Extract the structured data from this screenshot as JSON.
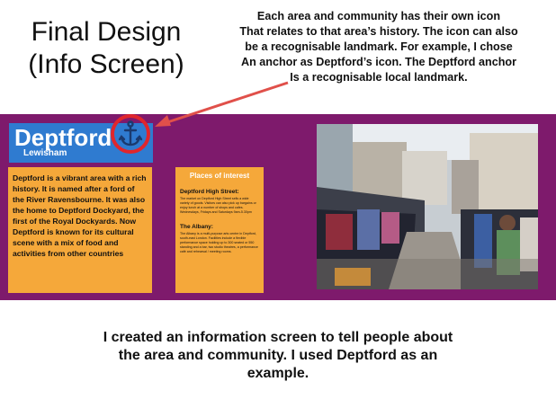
{
  "slide": {
    "title_line1": "Final Design",
    "title_line2": "(Info Screen)",
    "note_lines": [
      "Each area and community has their own icon",
      "That relates to that area’s history. The icon can also",
      "be a recognisable landmark. For example, I chose",
      "An anchor as Deptford’s icon. The Deptford anchor",
      "Is a recognisable local landmark."
    ],
    "caption_lines": [
      "I created an information screen to tell people about",
      "the area and community. I used Deptford as an",
      "example."
    ]
  },
  "screen": {
    "area_name": "Deptford",
    "borough": "Lewisham",
    "icon": "anchor-icon",
    "description": "Deptford is a vibrant area with a rich history. It is named after a ford of the River Ravensbourne. It was also the home to Deptford Dockyard, the first of the Royal Dockyards. Now Deptford is known for its cultural scene with a mix of food and activities from other countries",
    "places_heading": "Places of interest",
    "places": [
      {
        "name": "Deptford High Street:",
        "details": "The market on Deptford High Street sells a wide variety of goods. Visitors can also pick up bargains or enjoy lunch at a number of shops and cafes. Wednesdays, Fridays and Saturdays 9am-5.30pm"
      },
      {
        "name": "The Albany:",
        "details": "The Albany is a multi-purpose arts centre in Deptford, south-east London. Facilities include a flexible performance space holding up to 300 seated or 550 standing and a bar, two studio theatres, a performance café and rehearsal / meeting rooms."
      }
    ],
    "photo": "Street market photo"
  },
  "colors": {
    "band": "#7e1a6c",
    "header": "#2f7bd0",
    "panel": "#f5a83a",
    "highlight": "#e0262c"
  }
}
